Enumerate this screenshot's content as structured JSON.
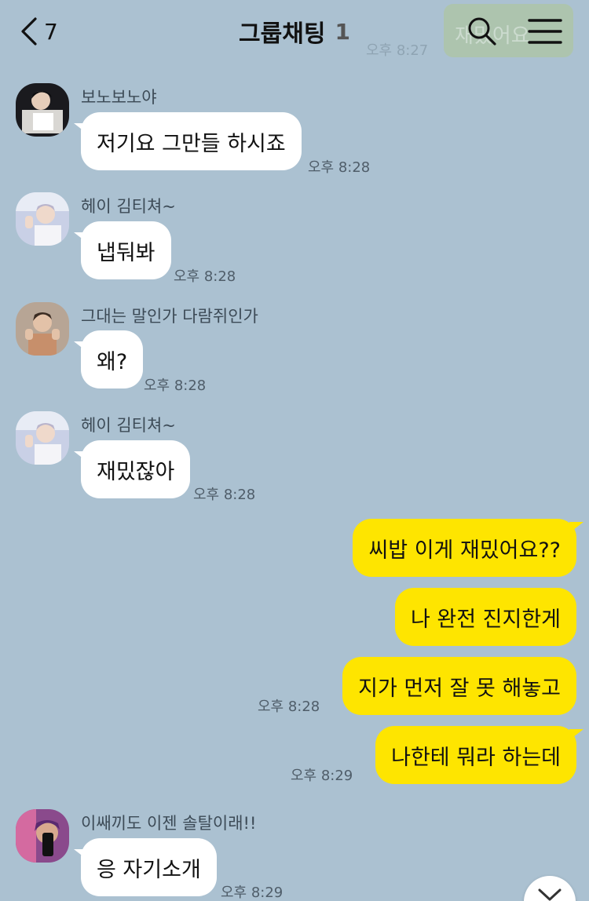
{
  "header": {
    "back_count": "7",
    "title": "그룹채팅",
    "member_count": "1",
    "notice_peek_text": "재밌어요",
    "notice_peek_time": "오후 8:27"
  },
  "messages": [
    {
      "sender": "보노보노야",
      "text": "저기요 그만들 하시죠",
      "time": "오후 8:28"
    },
    {
      "sender": "헤이 김티쳐~",
      "text": "냅둬봐",
      "time": "오후 8:28"
    },
    {
      "sender": "그대는 말인가 다람쥐인가",
      "text": "왜?",
      "time": "오후 8:28"
    },
    {
      "sender": "헤이 김티쳐~",
      "text": "재밌잖아",
      "time": "오후 8:28"
    },
    {
      "text": "씨밥 이게 재밌어요??",
      "mine": true
    },
    {
      "text": "나 완전 진지한게",
      "mine": true
    },
    {
      "text": "지가 먼저 잘 못 해놓고",
      "time": "오후 8:28",
      "mine": true
    },
    {
      "text": "나한테 뭐라 하는데",
      "time": "오후 8:29",
      "mine": true
    },
    {
      "sender": "이쌔끼도 이젠 솔탈이래!!",
      "text": "응 자기소개",
      "time": "오후 8:29"
    }
  ],
  "icons": {
    "back": "chevron-left-icon",
    "search": "search-icon",
    "menu": "hamburger-menu-icon",
    "scroll": "chevron-down-icon"
  },
  "colors": {
    "background": "#abc1d1",
    "incoming_bubble": "#ffffff",
    "outgoing_bubble": "#fee500"
  }
}
